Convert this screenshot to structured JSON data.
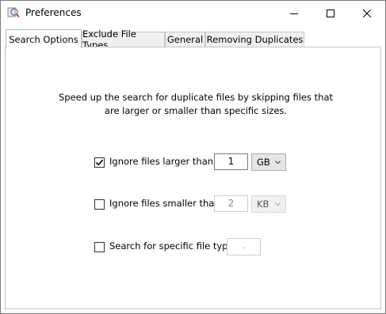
{
  "window": {
    "title": "Preferences",
    "icon": "magnifier-app-icon",
    "controls": [
      "minimize-icon",
      "maximize-icon",
      "close-icon"
    ]
  },
  "tabs": [
    {
      "label": "Search Options",
      "active": true
    },
    {
      "label": "Exclude File Types",
      "active": false
    },
    {
      "label": "General",
      "active": false
    },
    {
      "label": "Removing Duplicates",
      "active": false
    }
  ],
  "search_options": {
    "description": "Speed up the search for duplicate files by skipping files that are larger or smaller than specific sizes.",
    "larger": {
      "checked": true,
      "label": "Ignore files larger than",
      "value": "1",
      "unit": "GB",
      "enabled": true
    },
    "smaller": {
      "checked": false,
      "label": "Ignore files smaller than",
      "value": "2",
      "unit": "KB",
      "enabled": false
    },
    "filetype": {
      "checked": false,
      "label": "Search for specific file type",
      "value": "."
    }
  }
}
